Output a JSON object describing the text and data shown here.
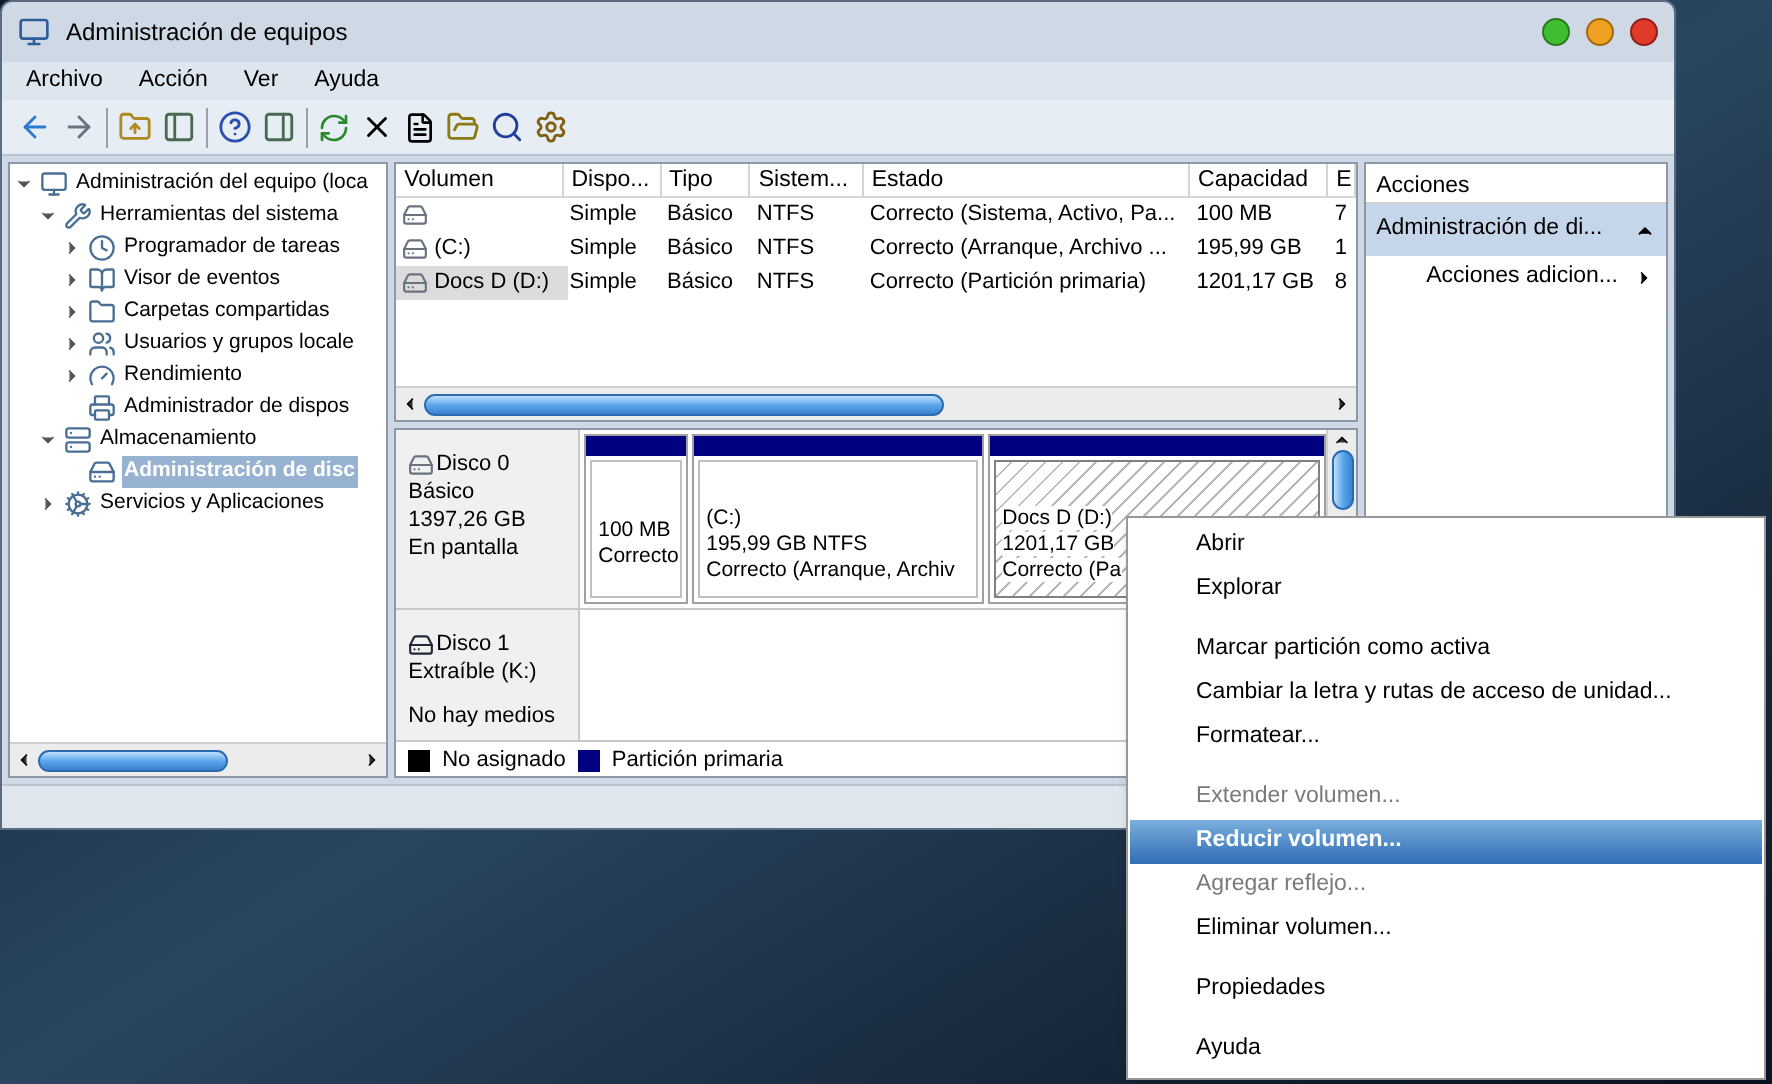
{
  "window": {
    "title": "Administración de equipos"
  },
  "menu_bar": [
    "Archivo",
    "Acción",
    "Ver",
    "Ayuda"
  ],
  "tree": [
    {
      "label": "Administración del equipo (loca",
      "expanded": true,
      "selected": false,
      "children": [
        {
          "label": "Herramientas del sistema",
          "expanded": true,
          "selected": false,
          "children": [
            {
              "label": "Programador de tareas",
              "expanded": false,
              "selected": false
            },
            {
              "label": "Visor de eventos",
              "expanded": false,
              "selected": false
            },
            {
              "label": "Carpetas compartidas",
              "expanded": false,
              "selected": false
            },
            {
              "label": "Usuarios y grupos locale",
              "expanded": false,
              "selected": false
            },
            {
              "label": "Rendimiento",
              "expanded": false,
              "selected": false
            },
            {
              "label": "Administrador de dispos",
              "selected": false
            }
          ]
        },
        {
          "label": "Almacenamiento",
          "expanded": true,
          "selected": false,
          "children": [
            {
              "label": "Administración de disc",
              "selected": true
            }
          ]
        },
        {
          "label": "Servicios y Aplicaciones",
          "expanded": false,
          "selected": false
        }
      ]
    }
  ],
  "volume_table": {
    "columns": [
      "Volumen",
      "Dispo...",
      "Tipo",
      "Sistem...",
      "Estado",
      "Capacidad",
      "E"
    ],
    "rows": [
      {
        "cells": [
          "",
          "Simple",
          "Básico",
          "NTFS",
          "Correcto (Sistema, Activo, Pa...",
          "100 MB",
          "7"
        ],
        "selected": false
      },
      {
        "cells": [
          "(C:)",
          "Simple",
          "Básico",
          "NTFS",
          "Correcto (Arranque, Archivo ...",
          "195,99 GB",
          "1"
        ],
        "selected": false
      },
      {
        "cells": [
          "Docs D (D:)",
          "Simple",
          "Básico",
          "NTFS",
          "Correcto (Partición primaria)",
          "1201,17 GB",
          "8"
        ],
        "selected": true
      }
    ]
  },
  "disks": [
    {
      "info": [
        "Disco 0",
        "Básico",
        "1397,26 GB",
        "En pantalla"
      ],
      "removable": false,
      "partitions": [
        {
          "lines": [
            "100 MB",
            "Correcto"
          ],
          "selected": false
        },
        {
          "lines": [
            "(C:)",
            "195,99 GB NTFS",
            "Correcto (Arranque, Archiv"
          ],
          "selected": false
        },
        {
          "lines": [
            "Docs D  (D:)",
            "1201,17 GB",
            "Correcto (Pa"
          ],
          "selected": true
        }
      ]
    },
    {
      "info": [
        "Disco 1",
        "Extraíble (K:)",
        "No hay medios"
      ],
      "removable": true
    }
  ],
  "legend": [
    {
      "label": "No asignado",
      "color": "#000000"
    },
    {
      "label": "Partición primaria",
      "color": "#000080"
    }
  ],
  "actions": {
    "title": "Acciones",
    "section": "Administración de di...",
    "expanded": true,
    "items": [
      "Acciones adicion..."
    ]
  },
  "context_menu": [
    [
      {
        "label": "Abrir",
        "disabled": false,
        "selected": false
      },
      {
        "label": "Explorar",
        "disabled": false,
        "selected": false
      }
    ],
    [
      {
        "label": "Marcar partición como activa",
        "disabled": false,
        "selected": false
      },
      {
        "label": "Cambiar la letra y rutas de acceso de unidad...",
        "disabled": false,
        "selected": false
      },
      {
        "label": "Formatear...",
        "disabled": false,
        "selected": false
      }
    ],
    [
      {
        "label": "Extender volumen...",
        "disabled": true,
        "selected": false
      },
      {
        "label": "Reducir volumen...",
        "disabled": false,
        "selected": true
      },
      {
        "label": "Agregar reflejo...",
        "disabled": true,
        "selected": false
      },
      {
        "label": "Eliminar volumen...",
        "disabled": false,
        "selected": false
      }
    ],
    [
      {
        "label": "Propiedades",
        "disabled": false,
        "selected": false
      }
    ],
    [
      {
        "label": "Ayuda",
        "disabled": false,
        "selected": false
      }
    ]
  ]
}
